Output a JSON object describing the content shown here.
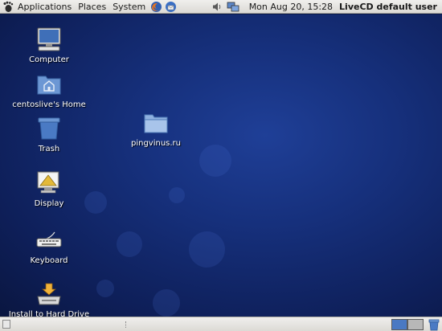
{
  "top_panel": {
    "menus": [
      {
        "label": "Applications"
      },
      {
        "label": "Places"
      },
      {
        "label": "System"
      }
    ],
    "launchers": [
      "firefox-icon",
      "thunderbird-icon"
    ],
    "tray": [
      "volume-icon",
      "network-icon"
    ],
    "clock": "Mon Aug 20, 15:28",
    "user": "LiveCD default user"
  },
  "desktop": {
    "icons": [
      {
        "label": "Computer",
        "icon": "computer-icon"
      },
      {
        "label": "centoslive's Home",
        "icon": "home-folder-icon"
      },
      {
        "label": "Trash",
        "icon": "trash-icon"
      },
      {
        "label": "Display",
        "icon": "display-icon"
      },
      {
        "label": "Keyboard",
        "icon": "keyboard-icon"
      },
      {
        "label": "Install to Hard Drive",
        "icon": "install-icon"
      },
      {
        "label": "pingvinus.ru",
        "icon": "folder-icon"
      }
    ]
  },
  "bottom_panel": {
    "workspaces": [
      "workspace-1",
      "workspace-2"
    ],
    "active_workspace": 1
  },
  "colors": {
    "panel": "#e6e4e0",
    "desktop_bg": "#16307c",
    "workspace_active": "#4a79c3"
  }
}
